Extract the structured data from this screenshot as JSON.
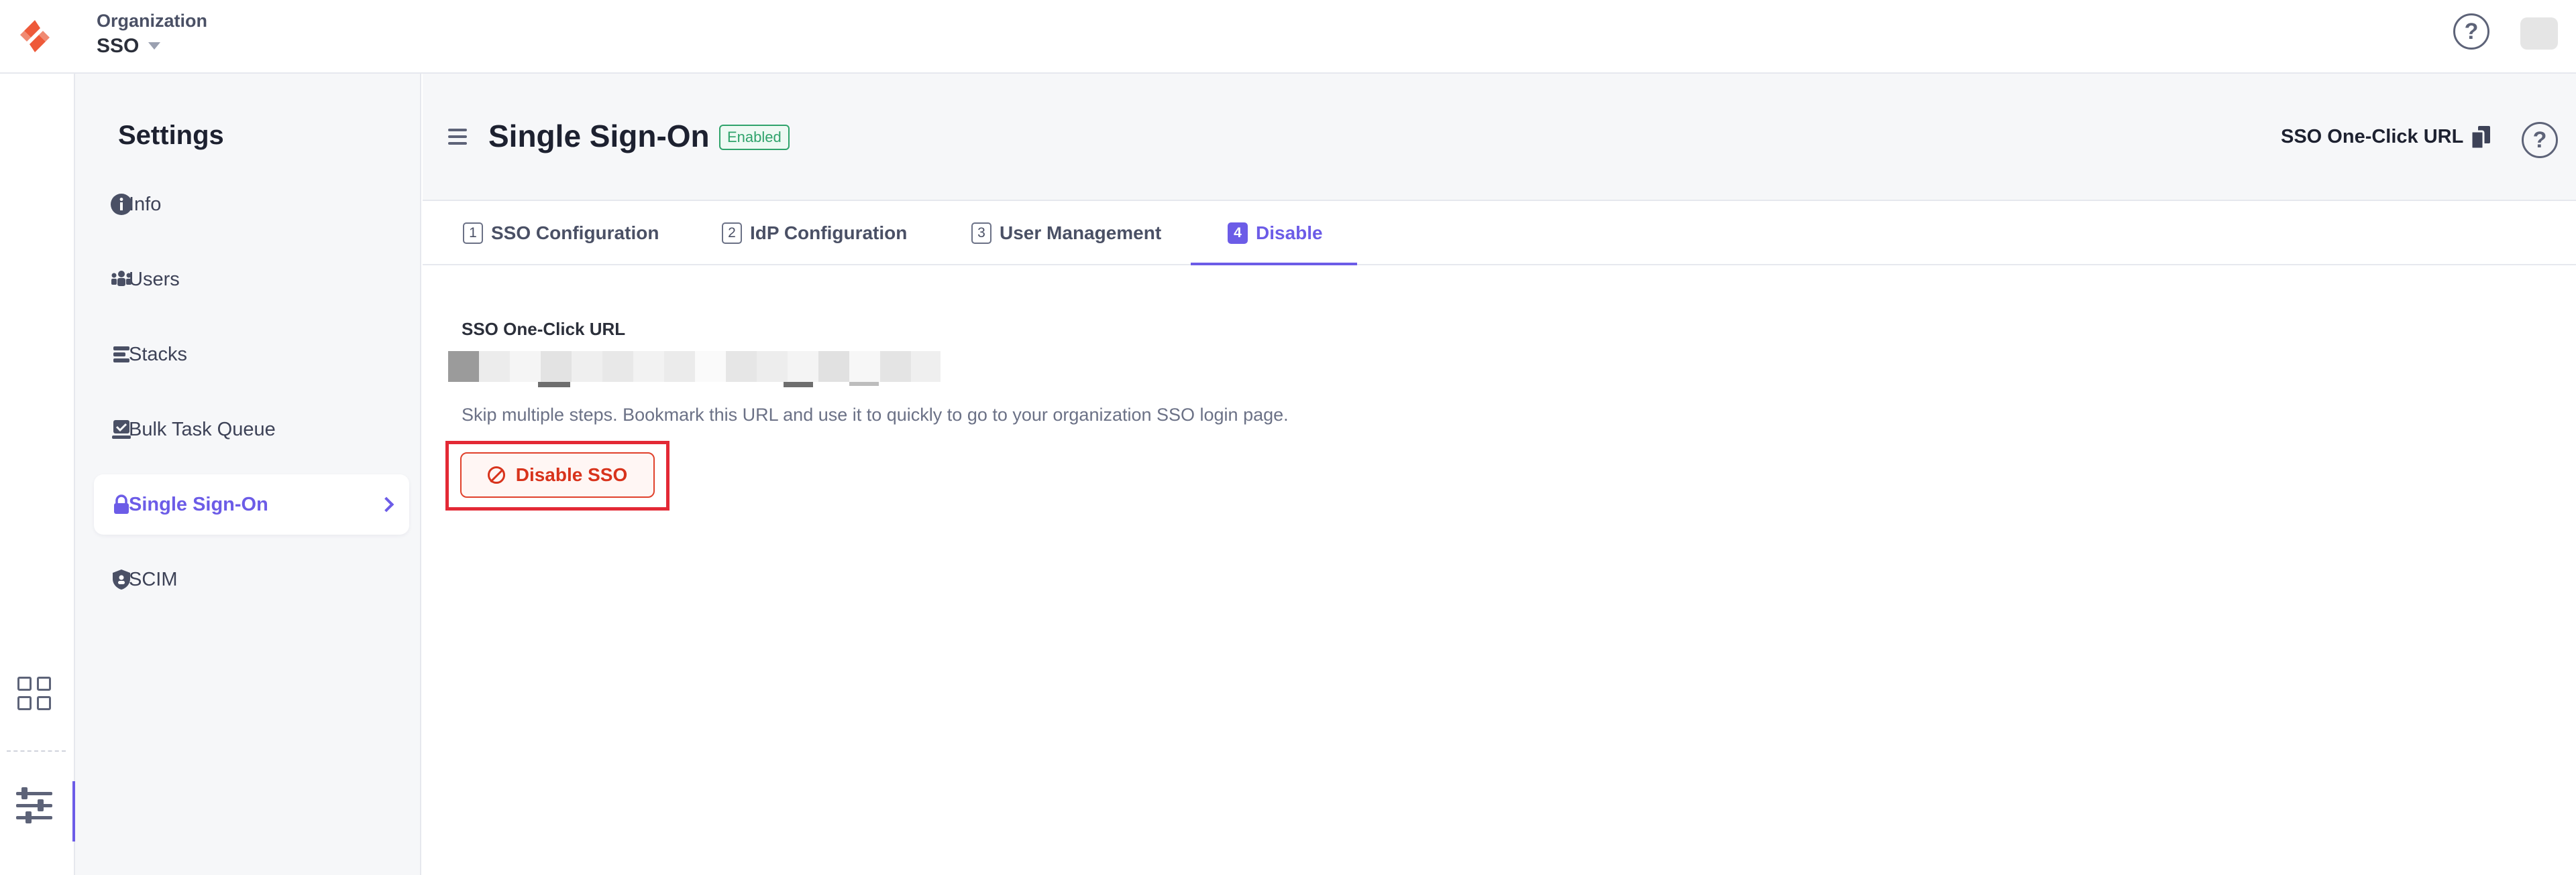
{
  "topbar": {
    "org_label": "Organization",
    "org_value": "SSO"
  },
  "sidebar": {
    "title": "Settings",
    "items": [
      {
        "label": "Info",
        "icon": "info-icon"
      },
      {
        "label": "Users",
        "icon": "users-icon"
      },
      {
        "label": "Stacks",
        "icon": "stacks-icon"
      },
      {
        "label": "Bulk Task Queue",
        "icon": "bulk-task-queue-icon"
      },
      {
        "label": "Single Sign-On",
        "icon": "lock-icon",
        "active": true
      },
      {
        "label": "SCIM",
        "icon": "scim-shield-icon"
      }
    ]
  },
  "header": {
    "title": "Single Sign-On",
    "status_badge": "Enabled",
    "one_click_link": "SSO One-Click URL"
  },
  "tabs": [
    {
      "num": "1",
      "label": "SSO Configuration"
    },
    {
      "num": "2",
      "label": "IdP Configuration"
    },
    {
      "num": "3",
      "label": "User Management"
    },
    {
      "num": "4",
      "label": "Disable",
      "active": true
    }
  ],
  "content": {
    "url_label": "SSO One-Click URL",
    "hint": "Skip multiple steps. Bookmark this URL and use it to quickly to go to your organization SSO login page.",
    "disable_button": "Disable SSO"
  },
  "colors": {
    "accent": "#6c5ce7",
    "danger": "#d8331c",
    "success": "#2fa36b",
    "highlight": "#e32935"
  }
}
